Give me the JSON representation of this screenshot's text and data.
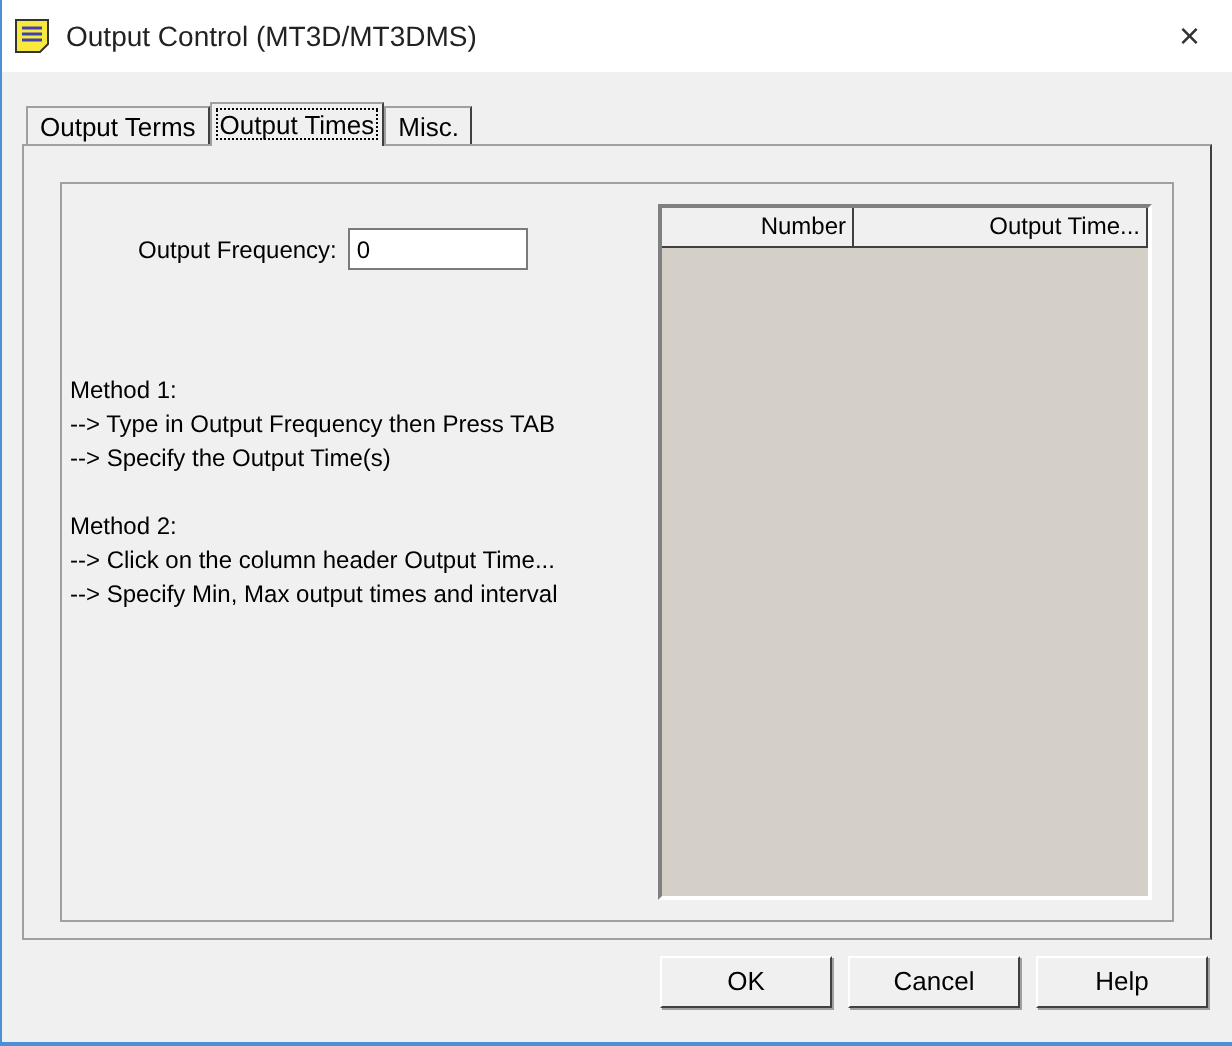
{
  "window": {
    "title": "Output Control (MT3D/MT3DMS)",
    "close": "×"
  },
  "tabs": [
    {
      "label": "Output Terms",
      "selected": false
    },
    {
      "label": "Output Times",
      "selected": true
    },
    {
      "label": "Misc.",
      "selected": false
    }
  ],
  "output_frequency": {
    "label": "Output Frequency:",
    "value": "0"
  },
  "instructions": [
    {
      "heading": "Method 1:",
      "steps": [
        "--> Type in Output Frequency then Press TAB",
        "--> Specify the Output Time(s)"
      ]
    },
    {
      "heading": "Method 2:",
      "steps": [
        "--> Click on the column header Output Time...",
        "--> Specify Min, Max output times and interval"
      ]
    }
  ],
  "table": {
    "columns": [
      "Number",
      "Output Time..."
    ]
  },
  "buttons": [
    "OK",
    "Cancel",
    "Help"
  ]
}
